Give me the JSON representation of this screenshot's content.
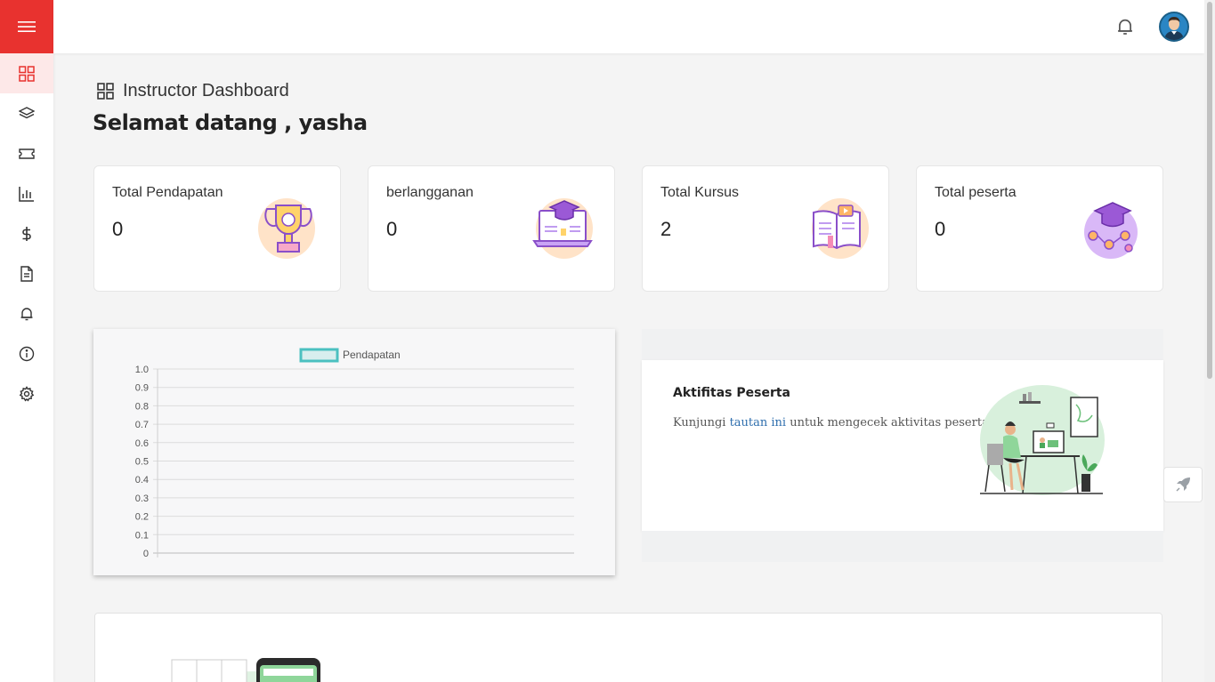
{
  "sidebar": {
    "items": [
      {
        "name": "dashboard",
        "icon": "grid-icon",
        "active": true
      },
      {
        "name": "courses",
        "icon": "layers-icon",
        "active": false
      },
      {
        "name": "coupons",
        "icon": "ticket-icon",
        "active": false
      },
      {
        "name": "reports",
        "icon": "bar-chart-icon",
        "active": false
      },
      {
        "name": "earnings",
        "icon": "dollar-icon",
        "active": false
      },
      {
        "name": "documents",
        "icon": "file-icon",
        "active": false
      },
      {
        "name": "notifications",
        "icon": "bell-icon",
        "active": false
      },
      {
        "name": "info",
        "icon": "info-icon",
        "active": false
      },
      {
        "name": "settings",
        "icon": "gear-icon",
        "active": false
      }
    ],
    "toggle_icon": "hamburger-icon"
  },
  "header": {
    "notification_icon": "bell-icon",
    "avatar_icon": "user-avatar"
  },
  "page": {
    "title": "Instructor Dashboard",
    "welcome": "Selamat datang , yasha"
  },
  "stats": [
    {
      "label": "Total Pendapatan",
      "value": "0",
      "icon": "trophy-icon"
    },
    {
      "label": "berlangganan",
      "value": "0",
      "icon": "laptop-graduation-icon"
    },
    {
      "label": "Total Kursus",
      "value": "2",
      "icon": "open-book-icon"
    },
    {
      "label": "Total peserta",
      "value": "0",
      "icon": "graduation-network-icon"
    }
  ],
  "chart_data": {
    "type": "line",
    "series": [
      {
        "name": "Pendapatan",
        "values": []
      }
    ],
    "categories": [],
    "y_ticks": [
      "1.0",
      "0.9",
      "0.8",
      "0.7",
      "0.6",
      "0.5",
      "0.4",
      "0.3",
      "0.2",
      "0.1",
      "0"
    ],
    "ylim": [
      0,
      1.0
    ],
    "grid": true,
    "legend": "top",
    "series_color": "#4bc0c0"
  },
  "activity": {
    "title": "Aktifitas Peserta",
    "desc_before": "Kunjungi ",
    "link_text": "tautan ini",
    "desc_after": " untuk mengecek aktivitas peserta"
  },
  "floating": {
    "icon": "rocket-icon"
  },
  "colors": {
    "accent": "#e8322f",
    "link": "#2f6fae",
    "chart_line": "#4bc0c0"
  }
}
